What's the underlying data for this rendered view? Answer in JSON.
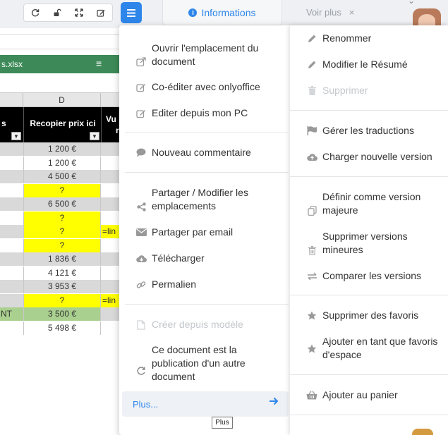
{
  "toolbar": {
    "buttons": [
      "refresh-icon",
      "unlock-icon",
      "fullscreen-icon",
      "edit-icon"
    ],
    "menu_icon": "hamburger-icon",
    "info_tab_label": "Informations",
    "voir_plus_label": "Voir plus",
    "accent": "#2e86ea"
  },
  "spreadsheet": {
    "filename": "s.xlsx",
    "columns": [
      "D"
    ],
    "headers": {
      "left": "s",
      "main": "Recopier prix ici",
      "right_1": "Vu",
      "right_2": "r"
    },
    "rows": [
      {
        "a": "",
        "d": "1 200 €",
        "e": "",
        "bg": "grey"
      },
      {
        "a": "",
        "d": "1 200 €",
        "e": "",
        "bg": "white"
      },
      {
        "a": "",
        "d": "4 500 €",
        "e": "",
        "bg": "grey"
      },
      {
        "a": "",
        "d": "?",
        "e": "",
        "bg": "yellow"
      },
      {
        "a": "",
        "d": "6 500 €",
        "e": "",
        "bg": "grey"
      },
      {
        "a": "",
        "d": "?",
        "e": "",
        "bg": "yellow"
      },
      {
        "a": "",
        "d": "?",
        "e": "=lin",
        "bg": "yellow"
      },
      {
        "a": "",
        "d": "?",
        "e": "",
        "bg": "yellow"
      },
      {
        "a": "",
        "d": "1 836 €",
        "e": "",
        "bg": "grey"
      },
      {
        "a": "",
        "d": "4 121 €",
        "e": "",
        "bg": "white"
      },
      {
        "a": "",
        "d": "3 953 €",
        "e": "",
        "bg": "grey"
      },
      {
        "a": "",
        "d": "?",
        "e": "=lin",
        "bg": "yellow"
      },
      {
        "a": "NT",
        "d": "3 500 €",
        "e": "",
        "bg": "green"
      },
      {
        "a": "",
        "d": "5 498 €",
        "e": "",
        "bg": "white"
      }
    ]
  },
  "menu_left": {
    "items": [
      {
        "label": "Ouvrir l'emplacement du document",
        "icon": "external-link-icon"
      },
      {
        "label": "Co-éditer avec onlyoffice",
        "icon": "edit-square-icon"
      },
      {
        "label": "Editer depuis mon PC",
        "icon": "edit-square-icon"
      },
      {
        "label": "Nouveau commentaire",
        "icon": "comment-icon"
      },
      {
        "label": "Partager / Modifier les emplacements",
        "icon": "share-icon"
      },
      {
        "label": "Partager par email",
        "icon": "envelope-icon"
      },
      {
        "label": "Télécharger",
        "icon": "cloud-download-icon"
      },
      {
        "label": "Permalien",
        "icon": "link-icon"
      },
      {
        "label": "Créer depuis modèle",
        "icon": "file-icon",
        "disabled": true
      },
      {
        "label": "Ce document est la publication d'un autre document",
        "icon": "sync-icon"
      }
    ],
    "plus_label": "Plus...",
    "tooltip": "Plus"
  },
  "menu_right": {
    "items": [
      {
        "label": "Renommer",
        "icon": "pencil-icon"
      },
      {
        "label": "Modifier le Résumé",
        "icon": "pencil-icon"
      },
      {
        "label": "Supprimer",
        "icon": "trash-icon",
        "disabled": true
      },
      {
        "label": "Gérer les traductions",
        "icon": "flag-icon"
      },
      {
        "label": "Charger nouvelle version",
        "icon": "cloud-upload-icon"
      },
      {
        "label": "Définir comme version majeure",
        "icon": "copy-icon"
      },
      {
        "label": "Supprimer versions mineures",
        "icon": "trash-icon"
      },
      {
        "label": "Comparer les versions",
        "icon": "exchange-icon"
      },
      {
        "label": "Supprimer des favoris",
        "icon": "star-icon"
      },
      {
        "label": "Ajouter en tant que favoris d'espace",
        "icon": "star-icon"
      },
      {
        "label": "Ajouter au panier",
        "icon": "basket-icon"
      }
    ]
  }
}
